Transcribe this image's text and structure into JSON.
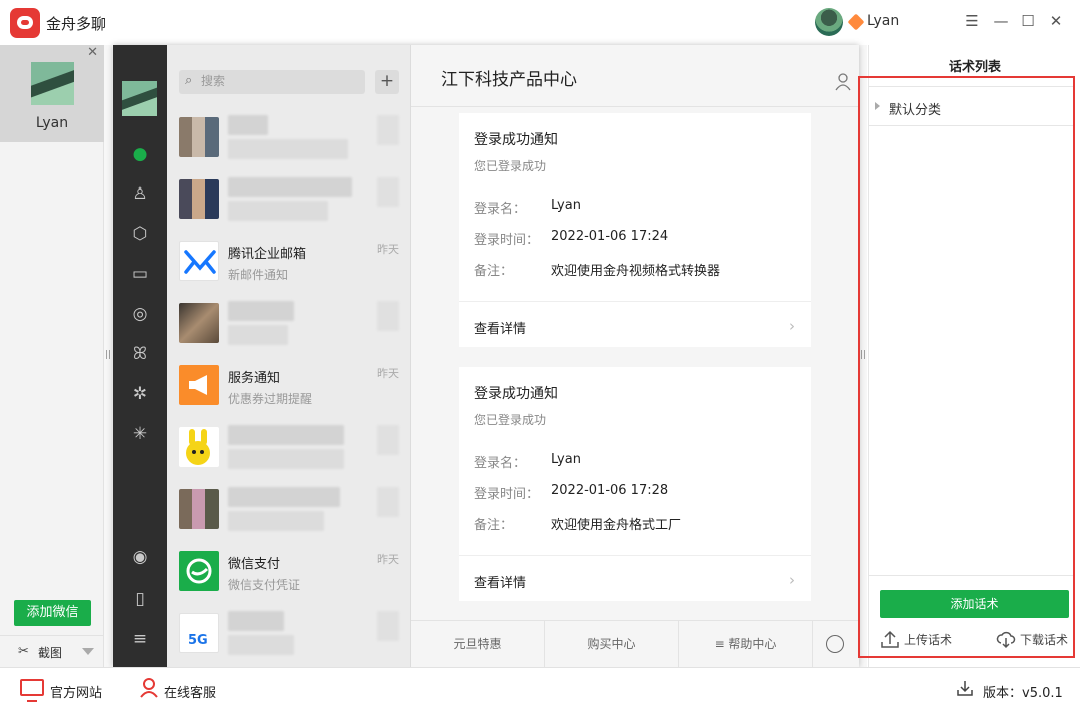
{
  "app": {
    "title": "金舟多聊",
    "user": "Lyan"
  },
  "accounts": {
    "items": [
      {
        "name": "Lyan"
      }
    ],
    "add_button": "添加微信",
    "screenshot_label": "截图"
  },
  "wechat": {
    "search_placeholder": "搜索",
    "chats": [
      {
        "name": "",
        "preview": "",
        "time": "",
        "blurred": true
      },
      {
        "name": "",
        "preview": "",
        "time": "",
        "blurred": true
      },
      {
        "name": "腾讯企业邮箱",
        "preview": "新邮件通知",
        "time": "昨天"
      },
      {
        "name": "",
        "preview": "",
        "time": "",
        "blurred": true
      },
      {
        "name": "服务通知",
        "preview": "优惠券过期提醒",
        "time": "昨天"
      },
      {
        "name": "",
        "preview": "",
        "time": "",
        "blurred": true
      },
      {
        "name": "",
        "preview": "",
        "time": "",
        "blurred": true
      },
      {
        "name": "微信支付",
        "preview": "微信支付凭证",
        "time": "昨天"
      },
      {
        "name": "",
        "preview": "",
        "time": "",
        "blurred": true
      }
    ],
    "chat_title": "江下科技产品中心",
    "messages": [
      {
        "title": "登录成功通知",
        "subtitle": "您已登录成功",
        "fields": [
          {
            "label": "登录名：",
            "value": "Lyan"
          },
          {
            "label": "登录时间：",
            "value": "2022-01-06 17:24"
          },
          {
            "label": "备注：",
            "value": "欢迎使用金舟视频格式转换器"
          }
        ],
        "detail": "查看详情"
      },
      {
        "title": "登录成功通知",
        "subtitle": "您已登录成功",
        "fields": [
          {
            "label": "登录名：",
            "value": "Lyan"
          },
          {
            "label": "登录时间：",
            "value": "2022-01-06 17:28"
          },
          {
            "label": "备注：",
            "value": "欢迎使用金舟格式工厂"
          }
        ],
        "detail": "查看详情"
      }
    ],
    "footer_menus": [
      "元旦特惠",
      "购买中心",
      "≡ 帮助中心"
    ]
  },
  "scripts_panel": {
    "title": "话术列表",
    "category": "默认分类",
    "add_button": "添加话术",
    "upload_label": "上传话术",
    "download_label": "下载话术"
  },
  "bottom": {
    "website": "官方网站",
    "support": "在线客服",
    "version": "版本：v5.0.1"
  },
  "colors": {
    "accent": "#1aad4a",
    "brand": "#e53935"
  }
}
